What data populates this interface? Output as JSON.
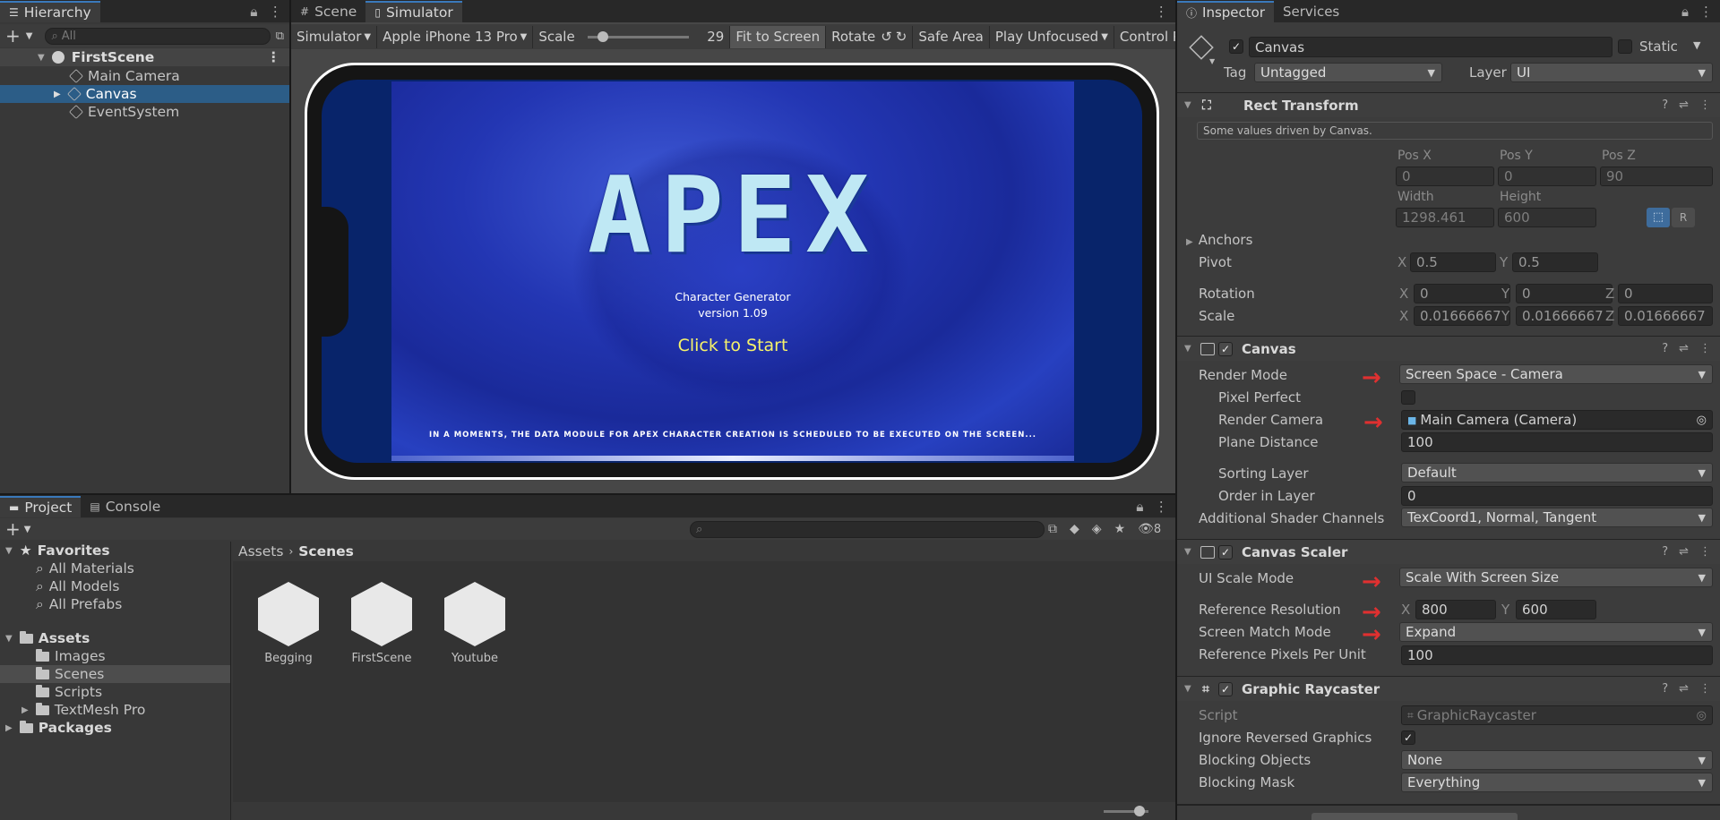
{
  "hierarchy": {
    "tab": "Hierarchy",
    "search_placeholder": "All",
    "scene": "FirstScene",
    "items": [
      "Main Camera",
      "Canvas",
      "EventSystem"
    ]
  },
  "center": {
    "tabs": [
      "Scene",
      "Simulator"
    ],
    "toolbar": {
      "mode": "Simulator",
      "device": "Apple iPhone 13 Pro",
      "scale_label": "Scale",
      "scale_value": "29",
      "scale_fraction": 0.1,
      "fit": "Fit to Screen",
      "rotate": "Rotate",
      "safe_area": "Safe Area",
      "play": "Play Unfocused",
      "control": "Control P"
    },
    "game": {
      "title": "APEX",
      "subtitle": "Character Generator",
      "version": "version 1.09",
      "start": "Click to Start",
      "ticker": "IN A MOMENTS, THE DATA MODULE FOR APEX CHARACTER CREATION IS SCHEDULED TO BE EXECUTED ON THE SCREEN..."
    }
  },
  "project": {
    "tabs": [
      "Project",
      "Console"
    ],
    "hidden_count": "8",
    "favorites_label": "Favorites",
    "favorites": [
      "All Materials",
      "All Models",
      "All Prefabs"
    ],
    "assets_label": "Assets",
    "asset_folders": [
      "Images",
      "Scenes",
      "Scripts",
      "TextMesh Pro"
    ],
    "packages_label": "Packages",
    "breadcrumb": [
      "Assets",
      "Scenes"
    ],
    "files": [
      "Begging",
      "FirstScene",
      "Youtube"
    ]
  },
  "inspector": {
    "tabs": [
      "Inspector",
      "Services"
    ],
    "object_name": "Canvas",
    "static_label": "Static",
    "tag_label": "Tag",
    "tag_value": "Untagged",
    "layer_label": "Layer",
    "layer_value": "UI",
    "rect": {
      "title": "Rect Transform",
      "note": "Some values driven by Canvas.",
      "pos_labels": [
        "Pos X",
        "Pos Y",
        "Pos Z"
      ],
      "pos_values": [
        "0",
        "0",
        "90"
      ],
      "size_labels": [
        "Width",
        "Height"
      ],
      "size_values": [
        "1298.461",
        "600"
      ],
      "anchors": "Anchors",
      "pivot": "Pivot",
      "pivot_values": [
        "0.5",
        "0.5"
      ],
      "rotation": "Rotation",
      "rotation_values": [
        "0",
        "0",
        "0"
      ],
      "scale": "Scale",
      "scale_values": [
        "0.01666667",
        "0.01666667",
        "0.01666667"
      ],
      "axis": [
        "X",
        "Y",
        "Z"
      ]
    },
    "canvas": {
      "title": "Canvas",
      "render_mode_label": "Render Mode",
      "render_mode": "Screen Space - Camera",
      "pixel_perfect_label": "Pixel Perfect",
      "render_camera_label": "Render Camera",
      "render_camera": "Main Camera (Camera)",
      "plane_distance_label": "Plane Distance",
      "plane_distance": "100",
      "sorting_layer_label": "Sorting Layer",
      "sorting_layer": "Default",
      "order_label": "Order in Layer",
      "order": "0",
      "shader_label": "Additional Shader Channels",
      "shader": "TexCoord1, Normal, Tangent"
    },
    "scaler": {
      "title": "Canvas Scaler",
      "mode_label": "UI Scale Mode",
      "mode": "Scale With Screen Size",
      "ref_label": "Reference Resolution",
      "ref_x": "800",
      "ref_y": "600",
      "match_label": "Screen Match Mode",
      "match": "Expand",
      "ppu_label": "Reference Pixels Per Unit",
      "ppu": "100"
    },
    "raycaster": {
      "title": "Graphic Raycaster",
      "script_label": "Script",
      "script": "GraphicRaycaster",
      "ignore_label": "Ignore Reversed Graphics",
      "blocking_label": "Blocking Objects",
      "blocking": "None",
      "mask_label": "Blocking Mask",
      "mask": "Everything"
    }
  },
  "colors": {
    "accent": "#2c5d87",
    "annotation": "#e03030",
    "game_bg": "#1c2fa8"
  }
}
